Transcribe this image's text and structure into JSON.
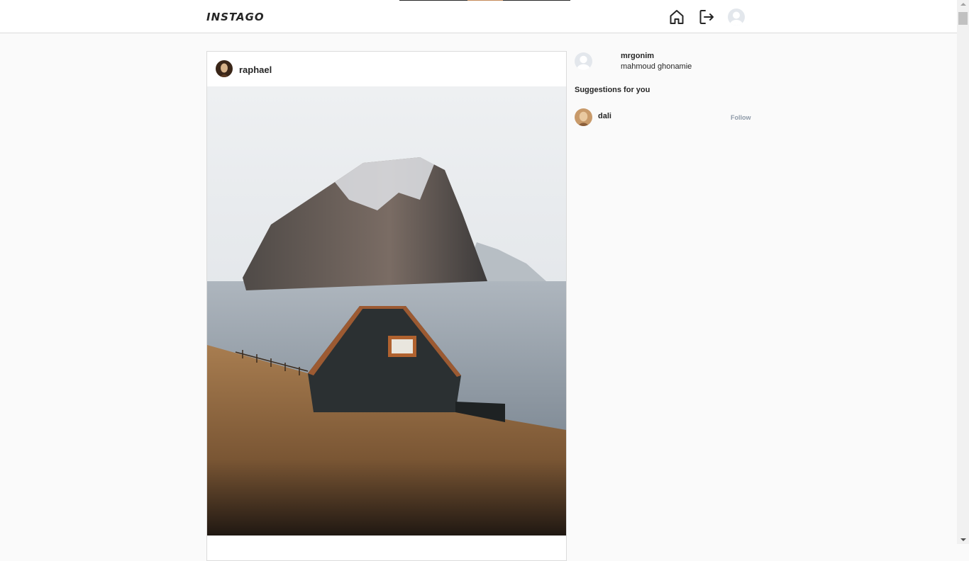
{
  "header": {
    "logo": "INSTAGO",
    "icons": [
      "home-icon",
      "logout-icon",
      "user-avatar"
    ]
  },
  "post": {
    "username": "raphael",
    "image_description_icon": "photo"
  },
  "sidebar": {
    "username": "mrgonim",
    "full_name": "mahmoud ghonamie",
    "suggestions_title": "Suggestions for you",
    "suggestions": [
      {
        "username": "dali",
        "action": "Follow"
      }
    ]
  },
  "colors": {
    "background": "#fafafa",
    "border": "#dbdbdb",
    "text": "#262626",
    "follow": "#8e9aa8"
  }
}
